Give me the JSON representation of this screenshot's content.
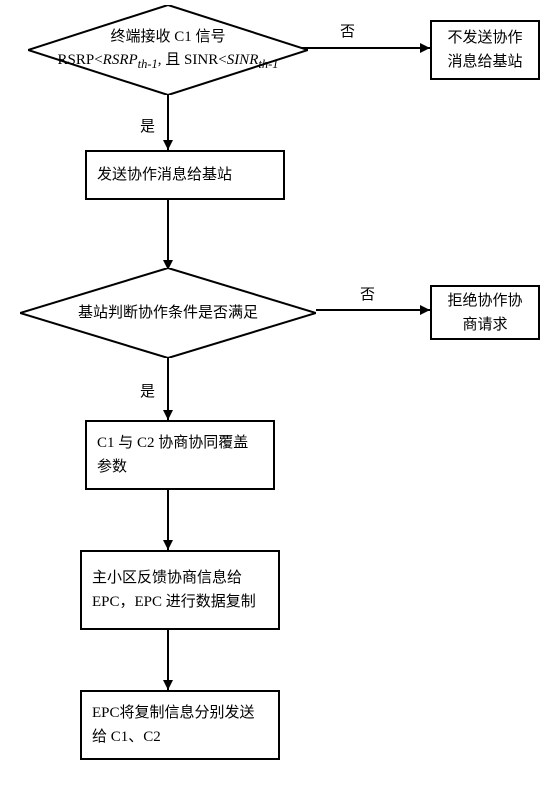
{
  "chart_data": {
    "type": "flowchart",
    "nodes": [
      {
        "id": "d1",
        "kind": "decision",
        "text": "终端接收 C1 信号\nRSRP < RSRP_th-1, 且 SINR < SINR_th-1"
      },
      {
        "id": "r1",
        "kind": "process",
        "text": "不发送协作消息给基站"
      },
      {
        "id": "r2",
        "kind": "process",
        "text": "发送协作消息给基站"
      },
      {
        "id": "d2",
        "kind": "decision",
        "text": "基站判断协作条件是否满足"
      },
      {
        "id": "r3",
        "kind": "process",
        "text": "拒绝协作协商请求"
      },
      {
        "id": "r4",
        "kind": "process",
        "text": "C1 与 C2 协商协同覆盖参数"
      },
      {
        "id": "r5",
        "kind": "process",
        "text": "主小区反馈协商信息给 EPC，EPC 进行数据复制"
      },
      {
        "id": "r6",
        "kind": "process",
        "text": "EPC将复制信息分别发送给 C1、C2"
      }
    ],
    "edges": [
      {
        "from": "d1",
        "to": "r1",
        "label": "否"
      },
      {
        "from": "d1",
        "to": "r2",
        "label": "是"
      },
      {
        "from": "r2",
        "to": "d2",
        "label": ""
      },
      {
        "from": "d2",
        "to": "r3",
        "label": "否"
      },
      {
        "from": "d2",
        "to": "r4",
        "label": "是"
      },
      {
        "from": "r4",
        "to": "r5",
        "label": ""
      },
      {
        "from": "r5",
        "to": "r6",
        "label": ""
      }
    ]
  },
  "labels": {
    "yes": "是",
    "no": "否"
  },
  "nodes": {
    "d1_line1_a": "终端接收 C1 信号",
    "d1_line2_a": "RSRP<",
    "d1_line2_b": "RSRP",
    "d1_line2_c": "th-1",
    "d1_line2_d": ",  且 SINR<",
    "d1_line2_e": "SINR",
    "d1_line2_f": "th-1",
    "r1": "不发送协作消息给基站",
    "r2": "发送协作消息给基站",
    "d2": "基站判断协作条件是否满足",
    "r3": "拒绝协作协商请求",
    "r4": "C1 与 C2 协商协同覆盖参数",
    "r5": "主小区反馈协商信息给EPC，EPC 进行数据复制",
    "r6": "EPC将复制信息分别发送给 C1、C2"
  }
}
